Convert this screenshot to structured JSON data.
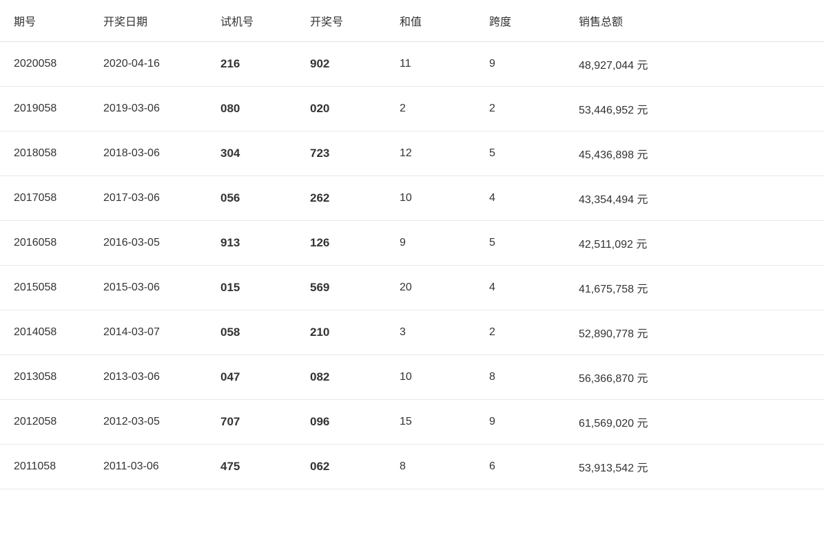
{
  "table": {
    "headers": [
      "期号",
      "开奖日期",
      "试机号",
      "开奖号",
      "和值",
      "跨度",
      "销售总额"
    ],
    "rows": [
      {
        "qihao": "2020058",
        "date": "2020-04-16",
        "shiji": "216",
        "kaijang": "902",
        "hezhi": "11",
        "kuadu": "9",
        "xiaoshou": "48,927,044 元"
      },
      {
        "qihao": "2019058",
        "date": "2019-03-06",
        "shiji": "080",
        "kaijang": "020",
        "hezhi": "2",
        "kuadu": "2",
        "xiaoshou": "53,446,952 元"
      },
      {
        "qihao": "2018058",
        "date": "2018-03-06",
        "shiji": "304",
        "kaijang": "723",
        "hezhi": "12",
        "kuadu": "5",
        "xiaoshou": "45,436,898 元"
      },
      {
        "qihao": "2017058",
        "date": "2017-03-06",
        "shiji": "056",
        "kaijang": "262",
        "hezhi": "10",
        "kuadu": "4",
        "xiaoshou": "43,354,494 元"
      },
      {
        "qihao": "2016058",
        "date": "2016-03-05",
        "shiji": "913",
        "kaijang": "126",
        "hezhi": "9",
        "kuadu": "5",
        "xiaoshou": "42,511,092 元"
      },
      {
        "qihao": "2015058",
        "date": "2015-03-06",
        "shiji": "015",
        "kaijang": "569",
        "hezhi": "20",
        "kuadu": "4",
        "xiaoshou": "41,675,758 元"
      },
      {
        "qihao": "2014058",
        "date": "2014-03-07",
        "shiji": "058",
        "kaijang": "210",
        "hezhi": "3",
        "kuadu": "2",
        "xiaoshou": "52,890,778 元"
      },
      {
        "qihao": "2013058",
        "date": "2013-03-06",
        "shiji": "047",
        "kaijang": "082",
        "hezhi": "10",
        "kuadu": "8",
        "xiaoshou": "56,366,870 元"
      },
      {
        "qihao": "2012058",
        "date": "2012-03-05",
        "shiji": "707",
        "kaijang": "096",
        "hezhi": "15",
        "kuadu": "9",
        "xiaoshou": "61,569,020 元"
      },
      {
        "qihao": "2011058",
        "date": "2011-03-06",
        "shiji": "475",
        "kaijang": "062",
        "hezhi": "8",
        "kuadu": "6",
        "xiaoshou": "53,913,542 元"
      }
    ]
  }
}
